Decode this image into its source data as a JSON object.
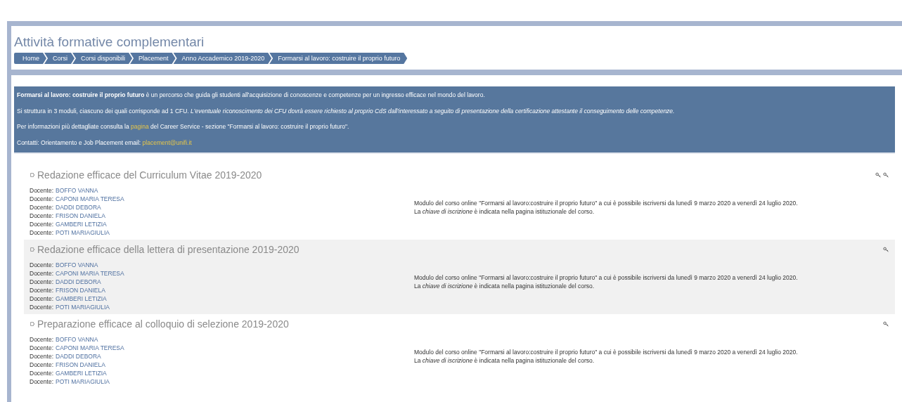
{
  "page": {
    "title": "Attività formative complementari"
  },
  "breadcrumb": [
    {
      "label": "Home"
    },
    {
      "label": "Corsi"
    },
    {
      "label": "Corsi disponibili"
    },
    {
      "label": "Placement"
    },
    {
      "label": "Anno Accademico 2019-2020"
    },
    {
      "label": "Formarsi al lavoro: costruire il proprio futuro"
    }
  ],
  "info": [
    {
      "parts": [
        {
          "kind": "text",
          "text": "**Formarsi al lavoro: costruire il proprio futuro** è un percorso che guida gli studenti all'acquisizione di conoscenze e competenze per un ingresso efficace nel mondo del lavoro."
        }
      ]
    },
    {
      "parts": [
        {
          "kind": "text",
          "text": "Si struttura in 3 moduli, ciascuno dei quali corrisponde ad 1 CFU. *L'eventuale riconoscimento dei CFU dovrà essere richiesto al proprio CdS dall'interessato a seguito di presentazione della certificazione attestante il conseguimento delle competenze.*"
        }
      ]
    },
    {
      "parts": [
        {
          "kind": "text",
          "text": "Per informazioni più dettagliate consulta la"
        },
        {
          "kind": "link",
          "text": "pagina"
        },
        {
          "kind": "text",
          "text": "del Career Service - sezione \"Formarsi al lavoro: costruire il proprio futuro\"."
        }
      ]
    },
    {
      "parts": [
        {
          "kind": "text",
          "text": "Contatti: Orientamento e Job Placement email:"
        },
        {
          "kind": "link",
          "text": "placement@unifi.it"
        }
      ]
    }
  ],
  "courses": [
    {
      "title": "Redazione efficace del Curriculum Vitae 2019-2020",
      "enrolment_icons": [
        {
          "kind": "key"
        },
        {
          "kind": "key"
        }
      ],
      "teachers": [
        {
          "label": "Docente:",
          "name": "BOFFO VANNA"
        },
        {
          "label": "Docente:",
          "name": "CAPONI MARIA TERESA"
        },
        {
          "label": "Docente:",
          "name": "DADDI DEBORA"
        },
        {
          "label": "Docente:",
          "name": "FRISON DANIELA"
        },
        {
          "label": "Docente:",
          "name": "GAMBERI LETIZIA"
        },
        {
          "label": "Docente:",
          "name": "POTI MARIAGIULIA"
        }
      ],
      "summary": [
        "Modulo del corso online \"Formarsi al lavoro:costruire il proprio futuro\" a cui è possibile iscriversi da lunedì 9 marzo 2020 a venerdì 24 luglio 2020.",
        "La *chiave di iscrizione* è indicata nella pagina istituzionale del corso."
      ]
    },
    {
      "title": "Redazione efficace della lettera di presentazione 2019-2020",
      "enrolment_icons": [
        {
          "kind": "key"
        }
      ],
      "teachers": [
        {
          "label": "Docente:",
          "name": "BOFFO VANNA"
        },
        {
          "label": "Docente:",
          "name": "CAPONI MARIA TERESA"
        },
        {
          "label": "Docente:",
          "name": "DADDI DEBORA"
        },
        {
          "label": "Docente:",
          "name": "FRISON DANIELA"
        },
        {
          "label": "Docente:",
          "name": "GAMBERI LETIZIA"
        },
        {
          "label": "Docente:",
          "name": "POTI MARIAGIULIA"
        }
      ],
      "summary": [
        "Modulo del corso online \"Formarsi al lavoro:costruire il proprio futuro\" a cui è possibile iscriversi da lunedì 9 marzo 2020 a venerdì 24 luglio 2020.",
        "La *chiave di iscrizione* è indicata nella pagina istituzionale del corso."
      ]
    },
    {
      "title": "Preparazione efficace al colloquio di selezione 2019-2020",
      "enrolment_icons": [
        {
          "kind": "key"
        }
      ],
      "teachers": [
        {
          "label": "Docente:",
          "name": "BOFFO VANNA"
        },
        {
          "label": "Docente:",
          "name": "CAPONI MARIA TERESA"
        },
        {
          "label": "Docente:",
          "name": "DADDI DEBORA"
        },
        {
          "label": "Docente:",
          "name": "FRISON DANIELA"
        },
        {
          "label": "Docente:",
          "name": "GAMBERI LETIZIA"
        },
        {
          "label": "Docente:",
          "name": "POTI MARIAGIULIA"
        }
      ],
      "summary": [
        "Modulo del corso online \"Formarsi al lavoro:costruire il proprio futuro\" a cui è possibile iscriversi da lunedì 9 marzo 2020 a venerdì 24 luglio 2020.",
        "La *chiave di iscrizione* è indicata nella pagina istituzionale del corso."
      ]
    }
  ]
}
